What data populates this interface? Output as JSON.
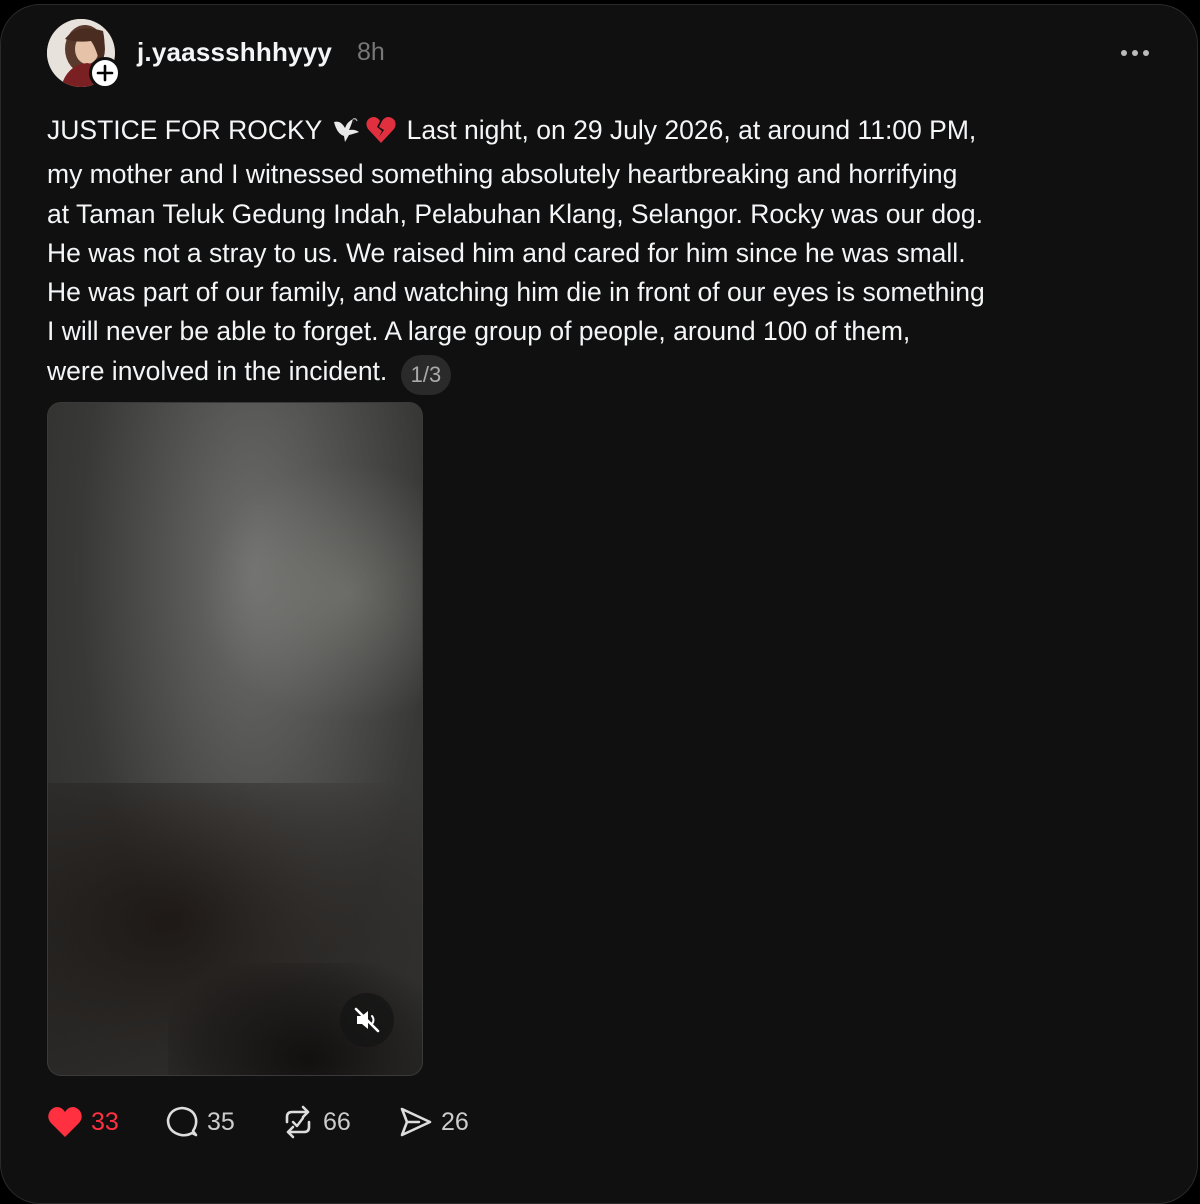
{
  "post": {
    "username": "j.yaassshhhyyy",
    "time": "8h",
    "text": {
      "line1_a": "JUSTICE FOR ROCKY",
      "line1_b": "Last night, on 29 July 2026, at around 11:00 PM,",
      "line2": "my mother and I witnessed something absolutely heartbreaking and horrifying",
      "line3": "at Taman Teluk Gedung Indah, Pelabuhan Klang, Selangor. Rocky was our dog.",
      "line4": "He was not a stray to us. We raised him and cared for him since he was small.",
      "line5": "He was part of our family, and watching him die in front of our eyes is something",
      "line6": "I will never be able to forget. A large group of people, around 100 of them,",
      "line7": "were involved in the incident."
    },
    "emojis": [
      "dove-icon",
      "broken-heart-icon"
    ],
    "thread_index": "1/3",
    "media": {
      "type": "video",
      "muted": true
    }
  },
  "actions": {
    "likes": "33",
    "comments": "35",
    "reposts": "66",
    "shares": "26",
    "liked": true
  },
  "colors": {
    "background": "#101010",
    "text": "#f3f5f7",
    "muted": "#777777",
    "like": "#ff3040"
  }
}
